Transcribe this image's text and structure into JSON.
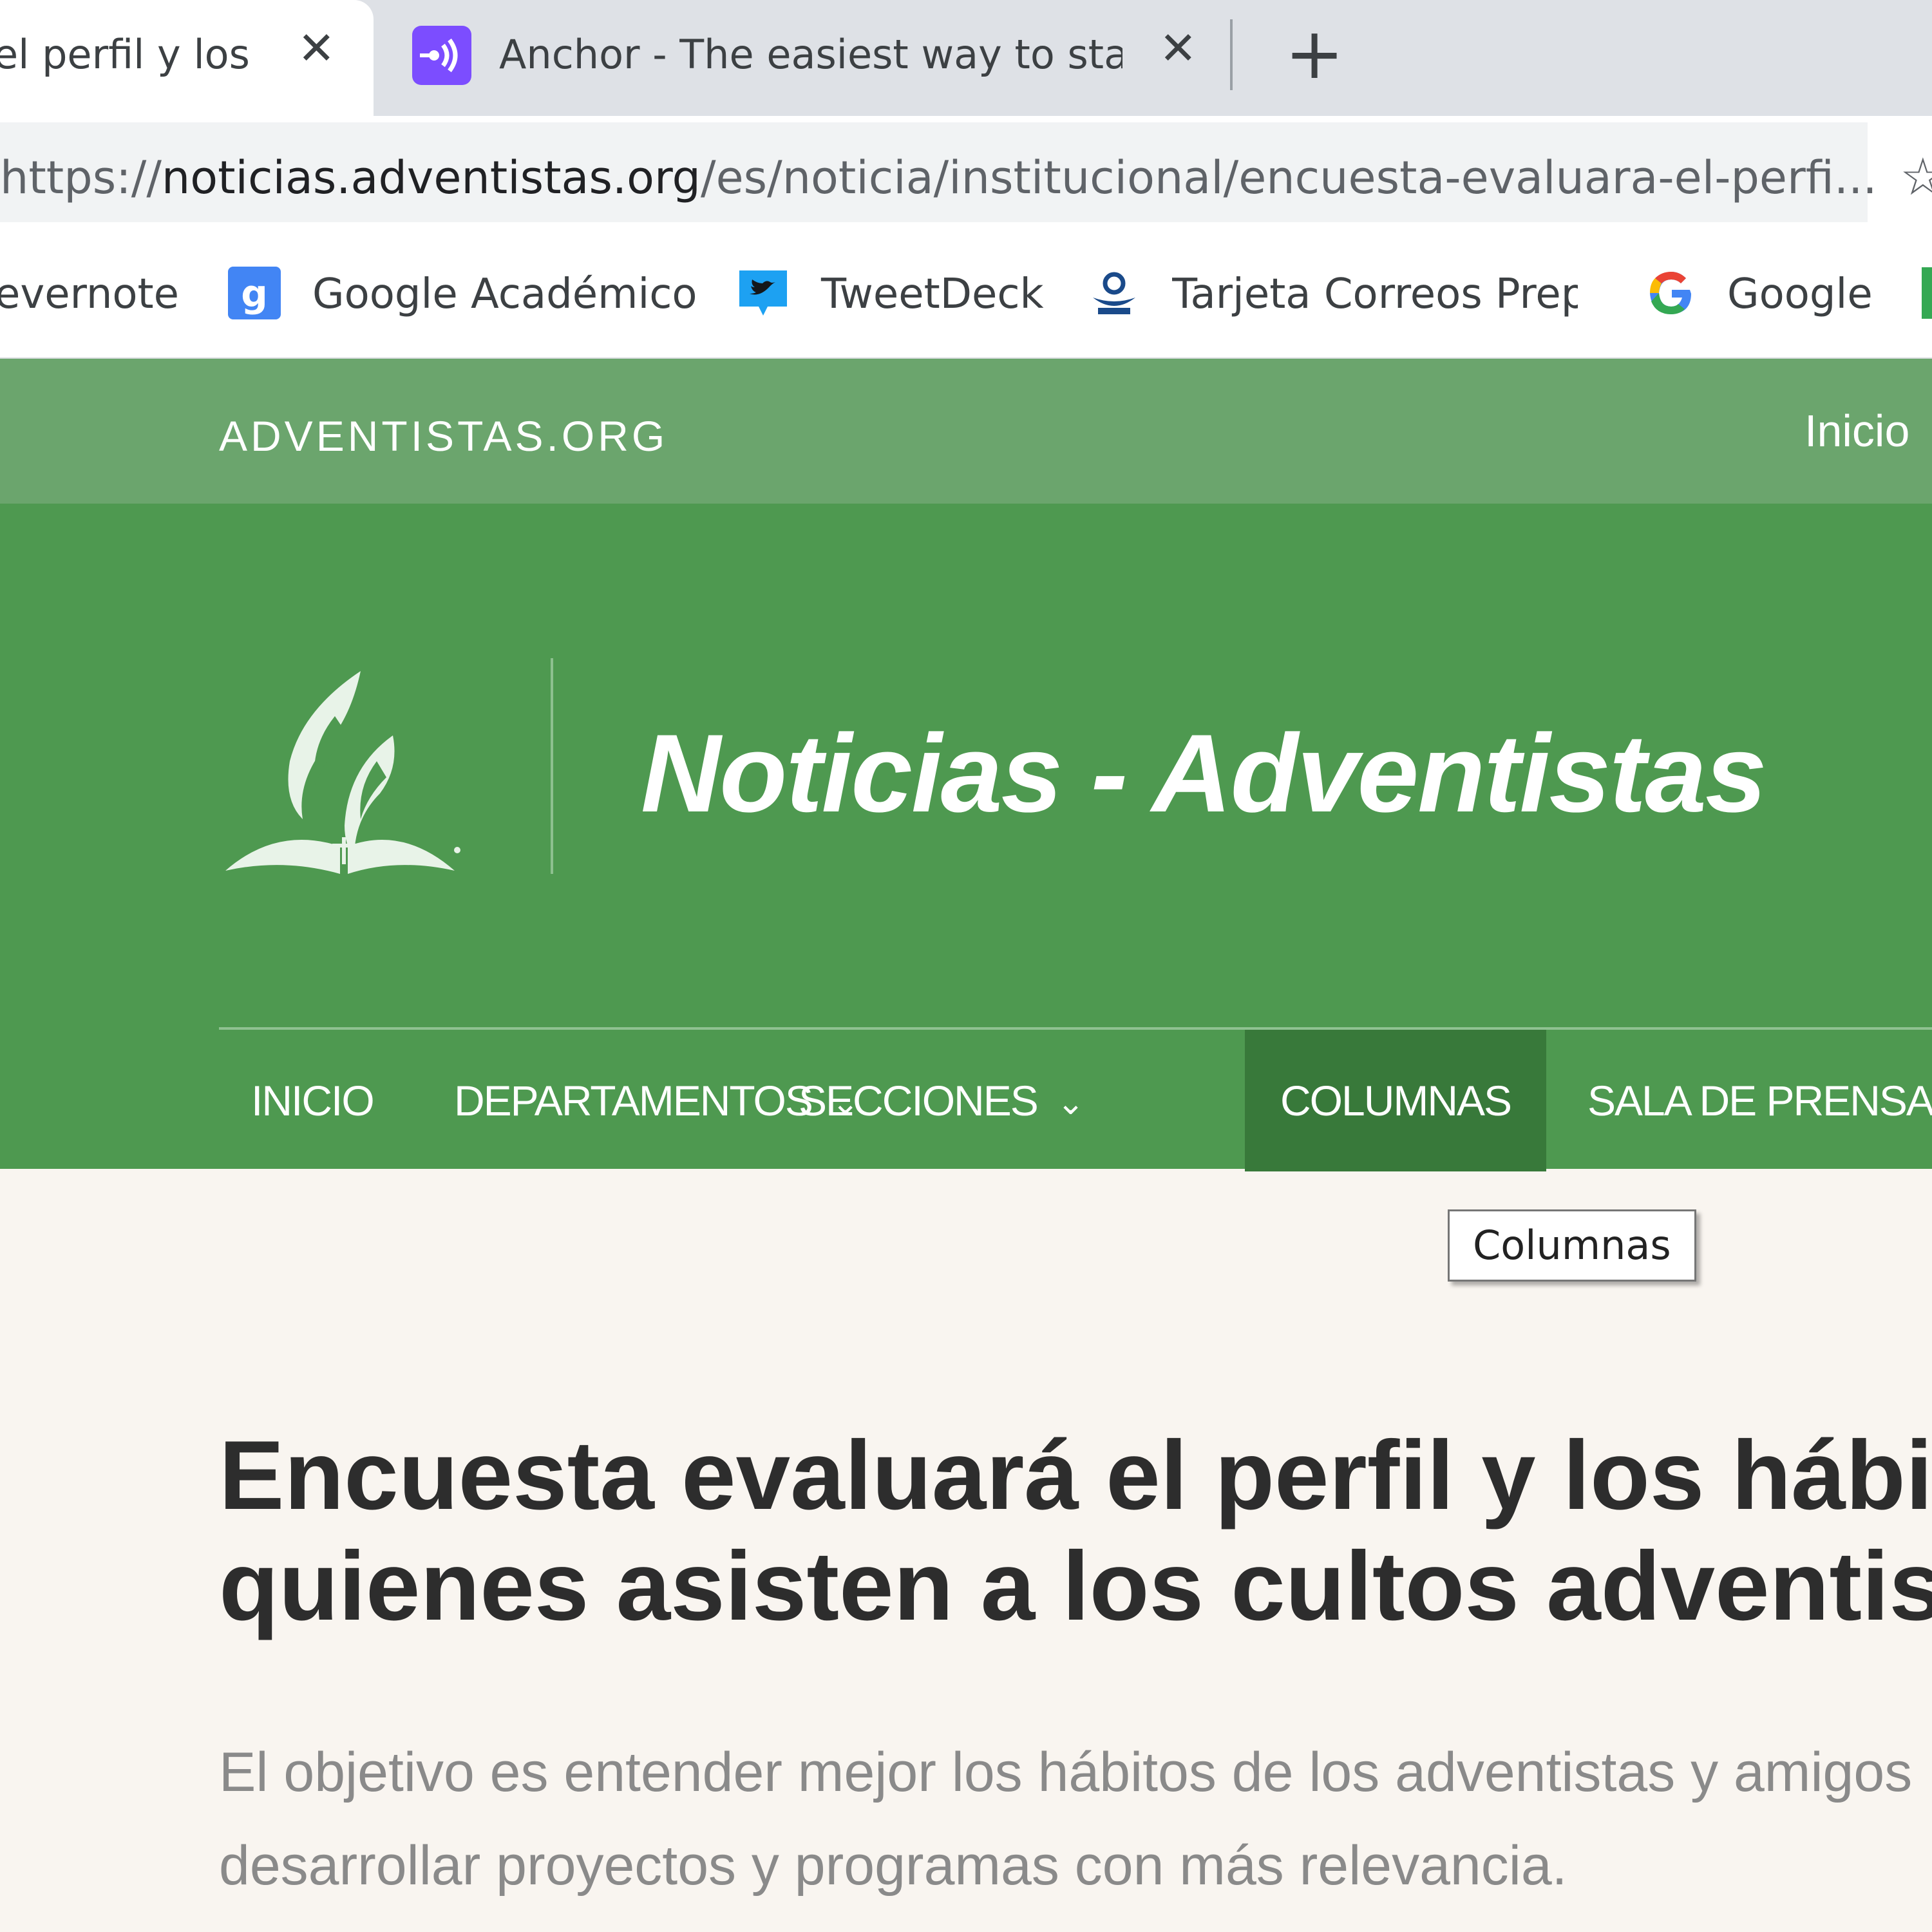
{
  "browser": {
    "tabs": [
      {
        "title": "el perfil y los h",
        "active": true
      },
      {
        "title": "Anchor - The easiest way to start",
        "active": false
      }
    ],
    "new_tab_glyph": "+",
    "close_glyph": "✕",
    "url_scheme": "https://",
    "url_host": "noticias.adventistas.org",
    "url_path": "/es/noticia/institucional/encuesta-evaluara-el-perfi...",
    "bookmarks": [
      {
        "label": "evernote",
        "icon": "evernote-icon"
      },
      {
        "label": "Google Académico",
        "icon": "google-scholar-icon"
      },
      {
        "label": "TweetDeck",
        "icon": "tweetdeck-icon"
      },
      {
        "label": "Tarjeta Correos Prepa",
        "icon": "correos-icon"
      },
      {
        "label": "Google",
        "icon": "google-icon"
      }
    ]
  },
  "site": {
    "topbar": {
      "brand": "ADVENTISTAS.ORG",
      "link": "Inicio"
    },
    "title": "Noticias - Adventistas",
    "nav": [
      {
        "label": "INICIO"
      },
      {
        "label": "DEPARTAMENTOS",
        "has_dropdown": true
      },
      {
        "label": "SECCIONES",
        "has_dropdown": true
      },
      {
        "label": "COLUMNAS",
        "active": true
      },
      {
        "label": "SALA DE PRENSA"
      }
    ],
    "chevron_glyph": "⌄",
    "tooltip": "Columnas"
  },
  "article": {
    "headline_line1": "Encuesta evaluará el perfil y los hábitos",
    "headline_line2": "quienes asisten a los cultos adventistas",
    "subtitle_line1": "El objetivo es entender mejor los hábitos de los adventistas y amigos",
    "subtitle_line2": "desarrollar proyectos y programas con más relevancia."
  },
  "colors": {
    "topbar": "#6ba56d",
    "header": "#4e9950",
    "nav_active": "#38793a",
    "page_bg": "#f9f5f0"
  }
}
